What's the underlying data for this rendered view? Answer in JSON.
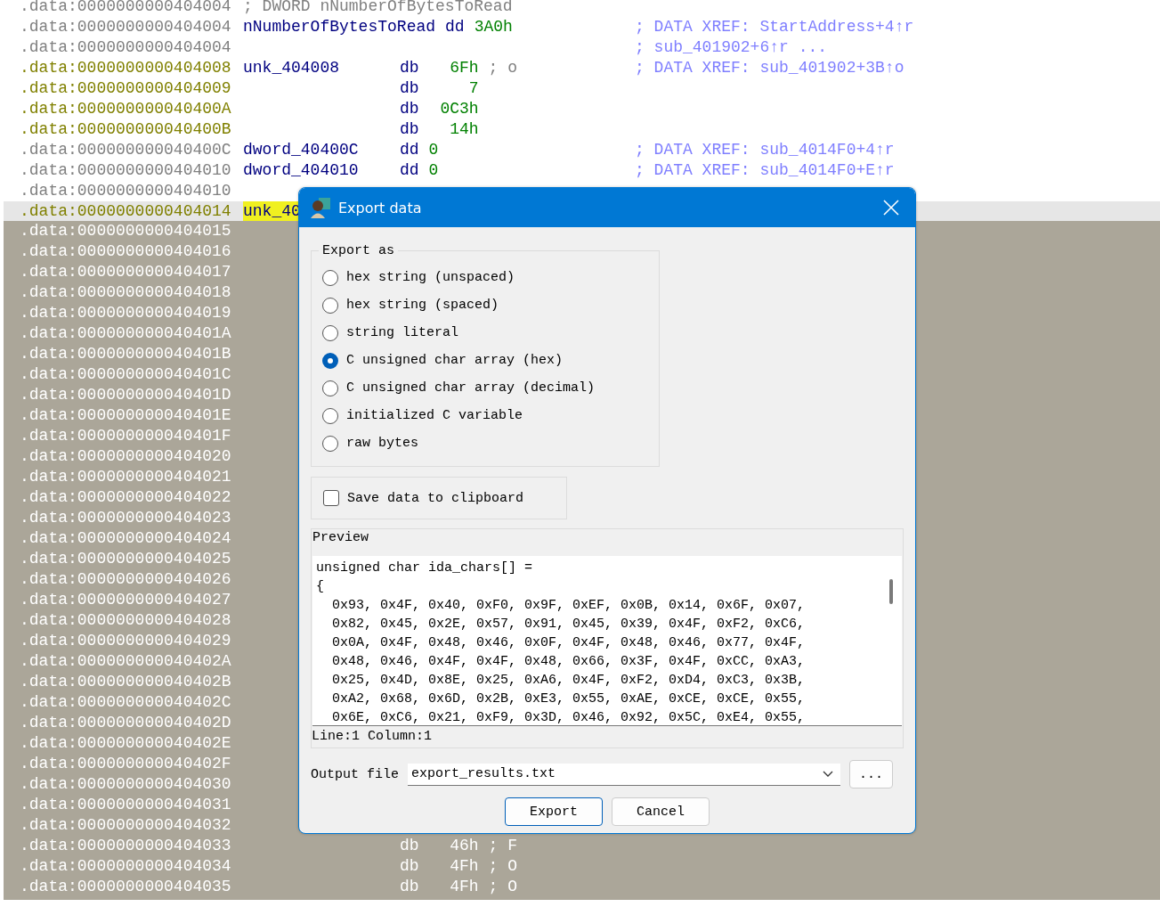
{
  "listing": {
    "rows": [
      {
        "address": ".data:0000000000404004",
        "kind": "comment",
        "name": "; DWORD nNumberOfBytesToRead",
        "selected": false
      },
      {
        "address": ".data:0000000000404004",
        "kind": "named",
        "name": "nNumberOfBytesToRead",
        "instr": "dd",
        "operand": "3A0h",
        "xref": "; DATA XREF: StartAddress+4↑r",
        "selected": false
      },
      {
        "address": ".data:0000000000404004",
        "kind": "blank",
        "xref": "; sub_401902+6↑r ...",
        "selected": false
      },
      {
        "address": ".data:0000000000404008",
        "kind": "byte",
        "name": "unk_404008",
        "instr": "db",
        "operand": "6Fh",
        "note": "; o",
        "xref": "; DATA XREF: sub_401902+3B↑o",
        "selected": false
      },
      {
        "address": ".data:0000000000404009",
        "kind": "byte",
        "instr": "db",
        "operand": "7",
        "selected": false
      },
      {
        "address": ".data:000000000040400A",
        "kind": "byte",
        "instr": "db",
        "operand": "0C3h",
        "selected": false
      },
      {
        "address": ".data:000000000040400B",
        "kind": "byte",
        "instr": "db",
        "operand": "14h",
        "selected": false
      },
      {
        "address": ".data:000000000040400C",
        "kind": "dword",
        "name": "dword_40400C",
        "instr": "dd",
        "operand": "0",
        "xref": "; DATA XREF: sub_4014F0+4↑r",
        "selected": false
      },
      {
        "address": ".data:0000000000404010",
        "kind": "dword",
        "name": "dword_404010",
        "instr": "dd",
        "operand": "0",
        "xref": "; DATA XREF: sub_4014F0+E↑r",
        "selected": false
      },
      {
        "address": ".data:0000000000404010",
        "kind": "blank",
        "selected": false
      },
      {
        "address": ".data:0000000000404014",
        "kind": "byte",
        "name": "unk_40",
        "selected": true
      }
    ]
  },
  "backdrop": {
    "rows": [
      {
        "address": ".data:0000000000404015"
      },
      {
        "address": ".data:0000000000404016"
      },
      {
        "address": ".data:0000000000404017"
      },
      {
        "address": ".data:0000000000404018"
      },
      {
        "address": ".data:0000000000404019"
      },
      {
        "address": ".data:000000000040401A"
      },
      {
        "address": ".data:000000000040401B"
      },
      {
        "address": ".data:000000000040401C"
      },
      {
        "address": ".data:000000000040401D"
      },
      {
        "address": ".data:000000000040401E"
      },
      {
        "address": ".data:000000000040401F"
      },
      {
        "address": ".data:0000000000404020"
      },
      {
        "address": ".data:0000000000404021"
      },
      {
        "address": ".data:0000000000404022"
      },
      {
        "address": ".data:0000000000404023"
      },
      {
        "address": ".data:0000000000404024"
      },
      {
        "address": ".data:0000000000404025"
      },
      {
        "address": ".data:0000000000404026"
      },
      {
        "address": ".data:0000000000404027"
      },
      {
        "address": ".data:0000000000404028"
      },
      {
        "address": ".data:0000000000404029"
      },
      {
        "address": ".data:000000000040402A"
      },
      {
        "address": ".data:000000000040402B"
      },
      {
        "address": ".data:000000000040402C"
      },
      {
        "address": ".data:000000000040402D"
      },
      {
        "address": ".data:000000000040402E"
      },
      {
        "address": ".data:000000000040402F"
      },
      {
        "address": ".data:0000000000404030"
      },
      {
        "address": ".data:0000000000404031"
      },
      {
        "address": ".data:0000000000404032"
      },
      {
        "address": ".data:0000000000404033",
        "instr": "db",
        "operand": "46h",
        "note": "; F"
      },
      {
        "address": ".data:0000000000404034",
        "instr": "db",
        "operand": "4Fh",
        "note": "; O"
      },
      {
        "address": ".data:0000000000404035",
        "instr": "db",
        "operand": "4Fh",
        "note": "; O"
      }
    ]
  },
  "dialog": {
    "title": "Export data",
    "export_as": {
      "legend": "Export as",
      "options": [
        {
          "label": "hex string (unspaced)",
          "selected": false
        },
        {
          "label": "hex string (spaced)",
          "selected": false
        },
        {
          "label": "string literal",
          "selected": false
        },
        {
          "label": "C unsigned char array (hex)",
          "selected": true
        },
        {
          "label": "C unsigned char array (decimal)",
          "selected": false
        },
        {
          "label": "initialized C variable",
          "selected": false
        },
        {
          "label": "raw bytes",
          "selected": false
        }
      ]
    },
    "clipboard": {
      "label": "Save data to clipboard",
      "checked": false
    },
    "preview": {
      "label": "Preview",
      "lines": [
        {
          "kind": "code",
          "text": "unsigned char ida_chars[] ="
        },
        {
          "kind": "code",
          "text": "{"
        },
        {
          "kind": "bytes",
          "text": "0x93, 0x4F, 0x40, 0xF0, 0x9F, 0xEF, 0x0B, 0x14, 0x6F, 0x07,"
        },
        {
          "kind": "bytes",
          "text": "0x82, 0x45, 0x2E, 0x57, 0x91, 0x45, 0x39, 0x4F, 0xF2, 0xC6,"
        },
        {
          "kind": "bytes",
          "text": "0x0A, 0x4F, 0x48, 0x46, 0x0F, 0x4F, 0x48, 0x46, 0x77, 0x4F,"
        },
        {
          "kind": "bytes",
          "text": "0x48, 0x46, 0x4F, 0x4F, 0x48, 0x66, 0x3F, 0x4F, 0xCC, 0xA3,"
        },
        {
          "kind": "bytes",
          "text": "0x25, 0x4D, 0x8E, 0x25, 0xA6, 0x4F, 0xF2, 0xD4, 0xC3, 0x3B,"
        },
        {
          "kind": "bytes",
          "text": "0xA2, 0x68, 0x6D, 0x2B, 0xE3, 0x55, 0xAE, 0xCE, 0xCE, 0x55,"
        },
        {
          "kind": "bytes",
          "text": "0x6E, 0xC6, 0x21, 0xF9, 0x3D, 0x46, 0x92, 0x5C, 0xE4, 0x55,"
        }
      ],
      "position": "Line:1  Column:1"
    },
    "output": {
      "label": "Output file",
      "value": "export_results.txt",
      "browse": "..."
    },
    "buttons": [
      {
        "label": "Export",
        "selected": true
      },
      {
        "label": "Cancel",
        "selected": false
      }
    ]
  }
}
